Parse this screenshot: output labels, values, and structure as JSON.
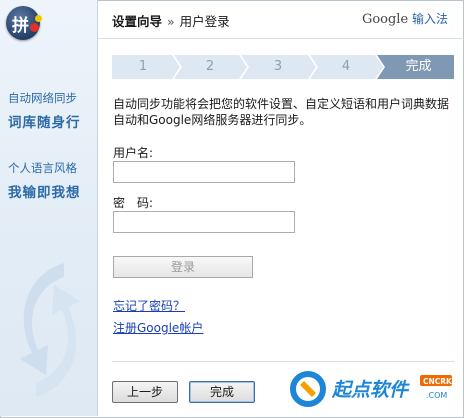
{
  "header": {
    "crumb_main": "设置向导",
    "crumb_sep": "»",
    "crumb_sub": "用户登录",
    "brand_google": "Google",
    "brand_ime": "输入法"
  },
  "sidebar": {
    "logo_glyph": "拼",
    "line1": "自动网络同步",
    "line2": "词库随身行",
    "line3": "个人语言风格",
    "line4": "我输即我想"
  },
  "steps": [
    "1",
    "2",
    "3",
    "4",
    "完成"
  ],
  "active_step": 5,
  "description": "自动同步功能将会把您的软件设置、自定义短语和用户词典数据自动和Google网络服务器进行同步。",
  "form": {
    "username_label": "用户名:",
    "password_label": "密　码:",
    "username_value": "",
    "password_value": "",
    "login_button": "登录",
    "forgot_link": "忘记了密码？",
    "register_link": "注册Google帐户"
  },
  "footer": {
    "back_button": "上一步",
    "finish_button": "完成"
  },
  "watermark": {
    "text": "起点软件",
    "badge": "CNCRK",
    "domain": ".COM"
  },
  "colors": {
    "step_inactive": "#dde8f2",
    "step_active": "#7f98b3",
    "sidebar_text": "#2d6aa8",
    "link": "#1a3fb4"
  }
}
